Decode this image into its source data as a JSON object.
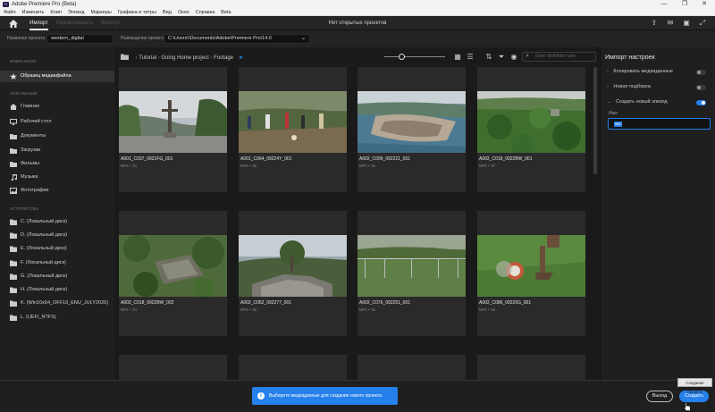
{
  "app": {
    "window_title": "Adobe Premiere Pro (Beta)",
    "icon_text": "Pr"
  },
  "menu": [
    "Файл",
    "Изменить",
    "Клип",
    "Эпизод",
    "Маркеры",
    "Графика и титры",
    "Вид",
    "Окно",
    "Справка",
    "Beta"
  ],
  "header": {
    "tabs": [
      "Импорт",
      "Редактировать",
      "Экспорт"
    ],
    "active_tab": "Импорт",
    "doc_title": "Нет открытых проектов"
  },
  "project": {
    "name_label": "Название проекта",
    "name_value": "western_digital",
    "location_label": "Размещение проекта",
    "location_value": "C:\\Users\\\\Documents\\Adobe\\Premiere Pro\\14.0"
  },
  "sidebar": {
    "favorites_heading": "ИЗБРАННОЕ",
    "favorites": [
      {
        "label": "Образец медиафайла",
        "icon": "star-icon"
      }
    ],
    "local_heading": "ЛОКАЛЬНЫЙ",
    "local": [
      {
        "label": "Главная",
        "icon": "home-icon"
      },
      {
        "label": "Рабочий стол",
        "icon": "monitor-icon"
      },
      {
        "label": "Документы",
        "icon": "document-icon"
      },
      {
        "label": "Загрузки",
        "icon": "download-icon"
      },
      {
        "label": "Фильмы",
        "icon": "film-icon"
      },
      {
        "label": "Музыка",
        "icon": "music-icon"
      },
      {
        "label": "Фотографии",
        "icon": "photo-icon"
      }
    ],
    "devices_heading": "УСТРОЙСТВА",
    "devices": [
      {
        "label": "C. (Локальный диск)"
      },
      {
        "label": "D. (Локальный диск)"
      },
      {
        "label": "E. (Локальный диск)"
      },
      {
        "label": "F. (Локальный диск)"
      },
      {
        "label": "G. (Локальный диск)"
      },
      {
        "label": "H. (Локальный диск)"
      },
      {
        "label": "K. (Win10x64_OFF19_ENU_JULY2020)"
      },
      {
        "label": "L. (UEFI_NTFS)"
      }
    ]
  },
  "breadcrumb": {
    "items": [
      "Tutorial",
      "Going Home project",
      "Footage"
    ],
    "separator": "›"
  },
  "search": {
    "placeholder": "Enter file/folder nam"
  },
  "clips": [
    {
      "name": "A001_C037_0921FG_001",
      "meta": "MP4 • :01"
    },
    {
      "name": "A001_C064_09224Y_001",
      "meta": "MP4 • :02"
    },
    {
      "name": "A002_C009_092221_001",
      "meta": "MP4 • :02"
    },
    {
      "name": "A002_C018_0922BW_001",
      "meta": "MP4 • :07"
    },
    {
      "name": "A002_C018_0922BW_002",
      "meta": "MP4 • :01"
    },
    {
      "name": "A002_C052_092277_001",
      "meta": "MP4 • :02"
    },
    {
      "name": "A002_C076_092251_001",
      "meta": "MP4 • :02"
    },
    {
      "name": "A002_C086_09220G_001",
      "meta": "MP4 • :02"
    }
  ],
  "import_settings": {
    "title": "Импорт настроек",
    "options": [
      {
        "label": "Копировать медиаданные",
        "on": false,
        "expanded": false
      },
      {
        "label": "Новая подборка",
        "on": false,
        "expanded": false
      },
      {
        "label": "Создать новый эпизод",
        "on": true,
        "expanded": true
      }
    ],
    "name_label": "Имя",
    "name_value": "ww"
  },
  "footer": {
    "toast": "Выберите медиаданные для создания нового проекта",
    "exit_label": "Выход",
    "create_label": "Создать",
    "tooltip": "Создание проекта"
  },
  "colors": {
    "accent": "#2680eb",
    "background": "#1d1d1d"
  }
}
